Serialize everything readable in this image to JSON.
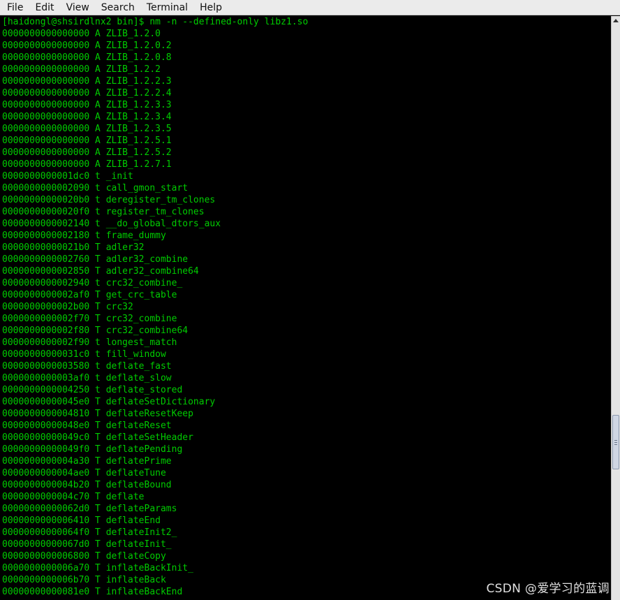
{
  "menu": [
    "File",
    "Edit",
    "View",
    "Search",
    "Terminal",
    "Help"
  ],
  "terminal": {
    "lines": [
      "[haidongl@shsirdlnx2 bin]$ nm -n --defined-only libz1.so",
      "0000000000000000 A ZLIB_1.2.0",
      "0000000000000000 A ZLIB_1.2.0.2",
      "0000000000000000 A ZLIB_1.2.0.8",
      "0000000000000000 A ZLIB_1.2.2",
      "0000000000000000 A ZLIB_1.2.2.3",
      "0000000000000000 A ZLIB_1.2.2.4",
      "0000000000000000 A ZLIB_1.2.3.3",
      "0000000000000000 A ZLIB_1.2.3.4",
      "0000000000000000 A ZLIB_1.2.3.5",
      "0000000000000000 A ZLIB_1.2.5.1",
      "0000000000000000 A ZLIB_1.2.5.2",
      "0000000000000000 A ZLIB_1.2.7.1",
      "0000000000001dc0 t _init",
      "0000000000002090 t call_gmon_start",
      "00000000000020b0 t deregister_tm_clones",
      "00000000000020f0 t register_tm_clones",
      "0000000000002140 t __do_global_dtors_aux",
      "0000000000002180 t frame_dummy",
      "00000000000021b0 T adler32",
      "0000000000002760 T adler32_combine",
      "0000000000002850 T adler32_combine64",
      "0000000000002940 t crc32_combine_",
      "0000000000002af0 T get_crc_table",
      "0000000000002b00 T crc32",
      "0000000000002f70 T crc32_combine",
      "0000000000002f80 T crc32_combine64",
      "0000000000002f90 t longest_match",
      "00000000000031c0 t fill_window",
      "0000000000003580 t deflate_fast",
      "0000000000003af0 t deflate_slow",
      "0000000000004250 t deflate_stored",
      "00000000000045e0 T deflateSetDictionary",
      "0000000000004810 T deflateResetKeep",
      "00000000000048e0 T deflateReset",
      "00000000000049c0 T deflateSetHeader",
      "00000000000049f0 T deflatePending",
      "0000000000004a30 T deflatePrime",
      "0000000000004ae0 T deflateTune",
      "0000000000004b20 T deflateBound",
      "0000000000004c70 T deflate",
      "00000000000062d0 T deflateParams",
      "0000000000006410 T deflateEnd",
      "00000000000064f0 T deflateInit2_",
      "00000000000067d0 T deflateInit_",
      "0000000000006800 T deflateCopy",
      "0000000000006a70 T inflateBackInit_",
      "0000000000006b70 T inflateBack",
      "00000000000081e0 T inflateBackEnd"
    ]
  },
  "watermark": "CSDN @爱学习的蓝调",
  "colors": {
    "terminal_fg": "#00cc00",
    "terminal_bg": "#000000",
    "menubar_bg": "#ebebeb"
  }
}
